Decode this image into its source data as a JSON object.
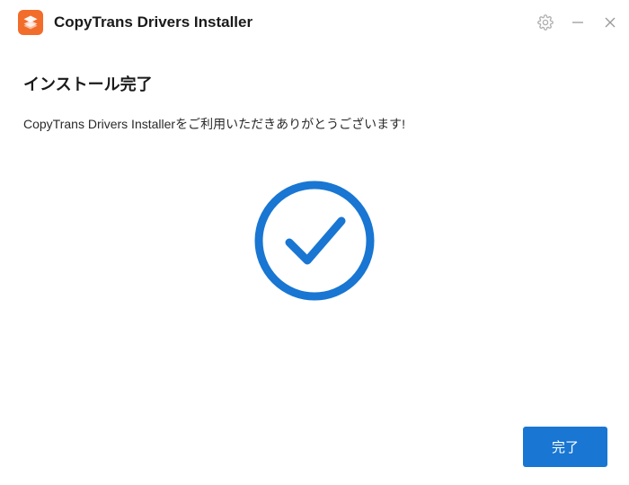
{
  "titlebar": {
    "app_title": "CopyTrans Drivers Installer"
  },
  "content": {
    "heading": "インストール完了",
    "message": "CopyTrans Drivers Installerをご利用いただきありがとうございます!"
  },
  "footer": {
    "complete_button": "完了"
  },
  "colors": {
    "accent": "#1976d2",
    "logo_bg": "#f26c2a"
  }
}
